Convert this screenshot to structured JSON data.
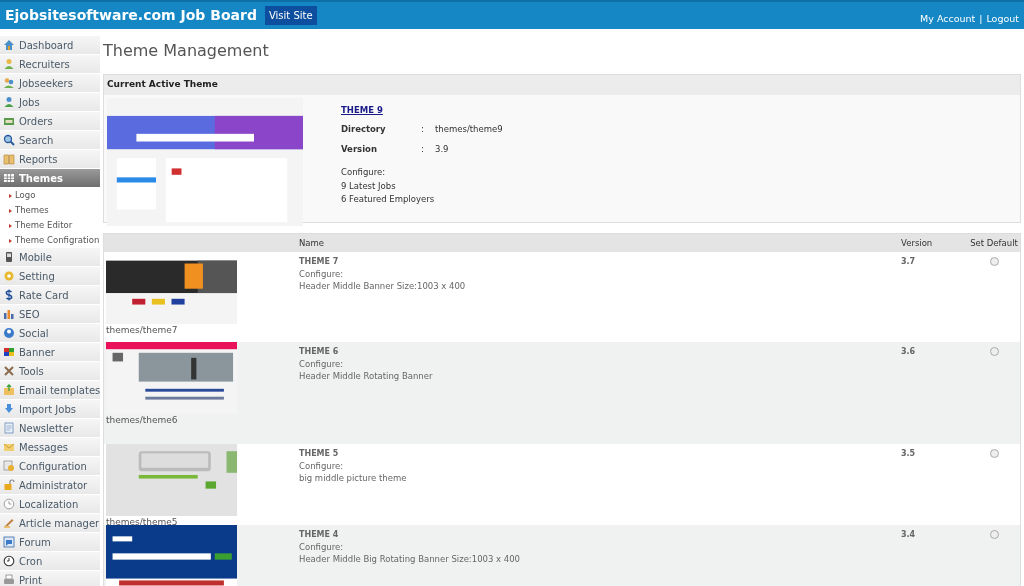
{
  "header": {
    "title": "Ejobsitesoftware.com Job Board",
    "visit_button": "Visit Site",
    "account_link": "My Account",
    "separator": "|",
    "logout_link": "Logout"
  },
  "sidebar": {
    "items": [
      {
        "label": "Dashboard",
        "selected": false
      },
      {
        "label": "Recruiters",
        "selected": false
      },
      {
        "label": "Jobseekers",
        "selected": false
      },
      {
        "label": "Jobs",
        "selected": false
      },
      {
        "label": "Orders",
        "selected": false
      },
      {
        "label": "Search",
        "selected": false
      },
      {
        "label": "Reports",
        "selected": false
      },
      {
        "label": "Themes",
        "selected": true,
        "children": [
          {
            "label": "Logo"
          },
          {
            "label": "Themes"
          },
          {
            "label": "Theme Editor"
          },
          {
            "label": "Theme Configration"
          }
        ]
      },
      {
        "label": "Mobile",
        "selected": false
      },
      {
        "label": "Setting",
        "selected": false
      },
      {
        "label": "Rate Card",
        "selected": false
      },
      {
        "label": "SEO",
        "selected": false
      },
      {
        "label": "Social",
        "selected": false
      },
      {
        "label": "Banner",
        "selected": false
      },
      {
        "label": "Tools",
        "selected": false
      },
      {
        "label": "Email templates",
        "selected": false
      },
      {
        "label": "Import Jobs",
        "selected": false
      },
      {
        "label": "Newsletter",
        "selected": false
      },
      {
        "label": "Messages",
        "selected": false
      },
      {
        "label": "Configuration",
        "selected": false
      },
      {
        "label": "Administrator",
        "selected": false
      },
      {
        "label": "Localization",
        "selected": false
      },
      {
        "label": "Article manager",
        "selected": false
      },
      {
        "label": "Forum",
        "selected": false
      },
      {
        "label": "Cron",
        "selected": false
      },
      {
        "label": "Print",
        "selected": false
      }
    ]
  },
  "page_title": "Theme Management",
  "active_theme": {
    "heading": "Current Active Theme",
    "name": "THEME 9",
    "fields": [
      {
        "label": "Directory",
        "separator": ":",
        "value": "themes/theme9"
      },
      {
        "label": "Version",
        "separator": ":",
        "value": "3.9"
      }
    ],
    "configure": [
      "Configure:",
      "9 Latest Jobs",
      "6 Featured Employers"
    ]
  },
  "table": {
    "columns": [
      "Name",
      "Version",
      "Set Default"
    ],
    "rows": [
      {
        "directory": "themes/theme7",
        "name": "THEME 7",
        "configure": [
          "Configure:",
          "Header Middle Banner Size:1003 x 400"
        ],
        "version": "3.7",
        "selected": false
      },
      {
        "directory": "themes/theme6",
        "name": "THEME 6",
        "configure": [
          "Configure:",
          "Header Middle Rotating Banner"
        ],
        "version": "3.6",
        "selected": false
      },
      {
        "directory": "themes/theme5",
        "name": "THEME 5",
        "configure": [
          "Configure:",
          "big middle picture theme"
        ],
        "version": "3.5",
        "selected": false
      },
      {
        "name": "THEME 4",
        "configure": [
          "Configure:",
          "Header Middle Big Rotating Banner Size:1003 x 400"
        ],
        "version": "3.4",
        "selected": false
      }
    ]
  }
}
